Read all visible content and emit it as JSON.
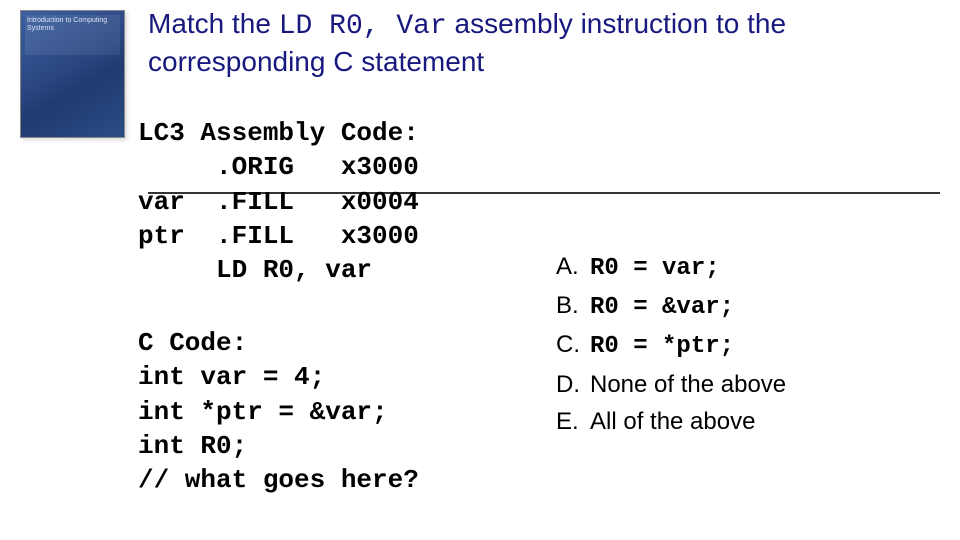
{
  "thumb": {
    "caption": "Introduction to Computing Systems"
  },
  "title": {
    "prefix": "Match the ",
    "code": "LD R0, Var",
    "suffix": " assembly instruction to the corresponding C statement"
  },
  "asm": {
    "l1": "LC3 Assembly Code:",
    "l2": "     .ORIG   x3000",
    "l3": "var  .FILL   x0004",
    "l4": "ptr  .FILL   x3000",
    "l5": "     LD R0, var"
  },
  "ccode": {
    "l1": "C Code:",
    "l2": "int var = 4;",
    "l3": "int *ptr = &var;",
    "l4": "int R0;",
    "l5": "// what goes here?"
  },
  "answers": {
    "a": {
      "letter": "A.",
      "text": "R0 = var;",
      "mono": true
    },
    "b": {
      "letter": "B.",
      "text": "R0 = &var;",
      "mono": true
    },
    "c": {
      "letter": "C.",
      "text": "R0 = *ptr;",
      "mono": true
    },
    "d": {
      "letter": "D.",
      "text": "None of the above",
      "mono": false
    },
    "e": {
      "letter": "E.",
      "text": "All of the above",
      "mono": false
    }
  }
}
